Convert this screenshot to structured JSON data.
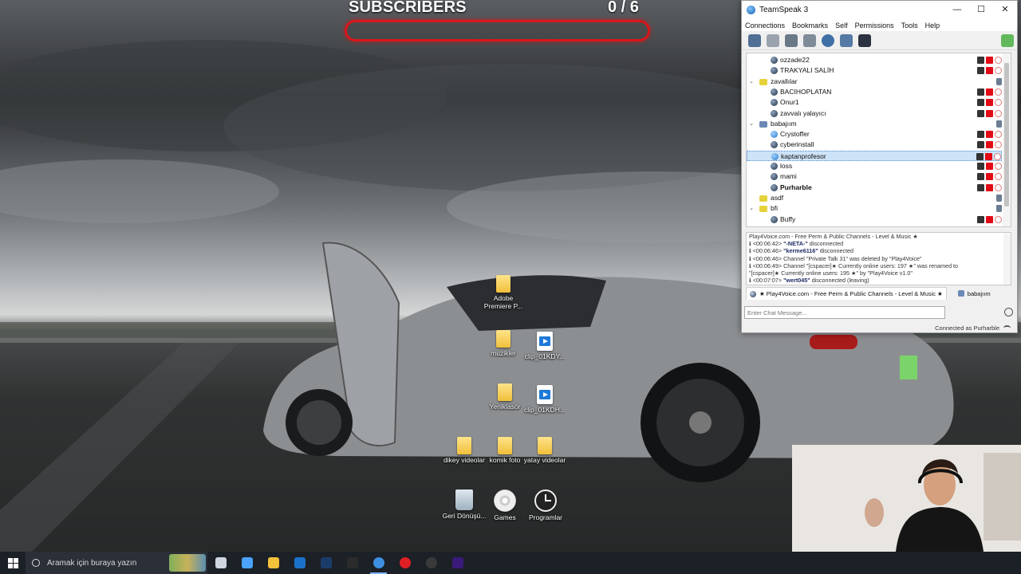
{
  "overlay": {
    "title": "SUBSCRIBERS",
    "count": "0  / 6",
    "progress_fraction": 0.0
  },
  "desktop": {
    "icons": [
      {
        "label": "Adobe Premiere P...",
        "kind": "folder"
      },
      {
        "label": "muzikler",
        "kind": "folder"
      },
      {
        "label": "clip_01KDY...",
        "kind": "video"
      },
      {
        "label": "Yeniklasör",
        "kind": "folder"
      },
      {
        "label": "clip_01KDH...",
        "kind": "video"
      },
      {
        "label": "dikey videolar",
        "kind": "folder"
      },
      {
        "label": "komik foto",
        "kind": "folder"
      },
      {
        "label": "yatay videolar",
        "kind": "folder"
      },
      {
        "label": "Geri Dönüşü...",
        "kind": "recycle-bin"
      },
      {
        "label": "Games",
        "kind": "disc"
      },
      {
        "label": "Programlar",
        "kind": "clock"
      }
    ]
  },
  "teamspeak": {
    "title": "TeamSpeak 3",
    "window_buttons": {
      "minimize": "—",
      "maximize": "☐",
      "close": "✕"
    },
    "menu": [
      "Connections",
      "Bookmarks",
      "Self",
      "Permissions",
      "Tools",
      "Help"
    ],
    "toolbar_icons": [
      "connect-icon",
      "disconnect-icon",
      "away-icon",
      "mute-mic-icon",
      "mute-speakers-icon",
      "subscribe-icon",
      "contacts-icon",
      "hotkey-icon",
      "whisper-icon"
    ],
    "tree": [
      {
        "type": "user",
        "label": "ozzade22",
        "bold": false
      },
      {
        "type": "user",
        "label": "TRAKYALI SALİH",
        "bold": false
      },
      {
        "type": "channel",
        "label": "zavallılar",
        "expanded": true
      },
      {
        "type": "user",
        "label": "BACIHOPLATAN",
        "bold": false
      },
      {
        "type": "user",
        "label": "Onur1",
        "bold": false
      },
      {
        "type": "user",
        "label": "zavvalı yalayıcı",
        "bold": false
      },
      {
        "type": "channel",
        "label": "babajıım",
        "expanded": true,
        "blue": true
      },
      {
        "type": "user",
        "label": "Crystoffer",
        "bold": false,
        "talking": true
      },
      {
        "type": "user",
        "label": "cyberinstall",
        "bold": false
      },
      {
        "type": "user",
        "label": "kaptanprofesor",
        "bold": false,
        "selected": true,
        "talking": true
      },
      {
        "type": "user",
        "label": "loss",
        "bold": false
      },
      {
        "type": "user",
        "label": "mami",
        "bold": false
      },
      {
        "type": "user",
        "label": "Purharble",
        "bold": true
      },
      {
        "type": "channel",
        "label": "asdf",
        "expanded": false
      },
      {
        "type": "channel",
        "label": "bfi",
        "expanded": true
      },
      {
        "type": "user",
        "label": "Buffy",
        "bold": false
      }
    ],
    "log": [
      {
        "time": "",
        "text": "Play4Voice.com - Free Perm & Public Channels - Level & Music ★",
        "strong": ""
      },
      {
        "time": "<00:06:42>",
        "strong": "\"-NETA-\"",
        "text": " disconnected"
      },
      {
        "time": "<00:06:46>",
        "strong": "\"kerme6116\"",
        "text": " disconnected"
      },
      {
        "time": "<00:06:46>",
        "strong": "",
        "text": "Channel \"Private Talk 31\" was deleted by \"Play4Voice\""
      },
      {
        "time": "<00:06:49>",
        "strong": "",
        "text": "Channel \"[cspacer]★ Currently online users: 197 ★\" was renamed to"
      },
      {
        "time": "",
        "strong": "",
        "text": "\"[cspacer]★ Currently online users: 195 ★\" by \"Play4Voice v1.0\""
      },
      {
        "time": "<00:07:07>",
        "strong": "\"wert045\"",
        "text": " disconnected (leaving)"
      }
    ],
    "tabs": [
      {
        "label": "★ Play4Voice.com - Free Perm & Public Channels - Level & Music ★",
        "active": true
      },
      {
        "label": "babajıım",
        "active": false
      }
    ],
    "chat_placeholder": "Enter Chat Message...",
    "status": "Connected as Purharble"
  },
  "taskbar": {
    "search_placeholder": "Aramak için buraya yazın",
    "apps": [
      "task-view-icon",
      "copilot-icon",
      "file-explorer-icon",
      "outlook-icon",
      "steam-icon",
      "epic-games-icon",
      "teamspeak-icon",
      "opera-icon",
      "obs-icon",
      "premiere-icon"
    ],
    "active_app": "teamspeak-icon"
  }
}
